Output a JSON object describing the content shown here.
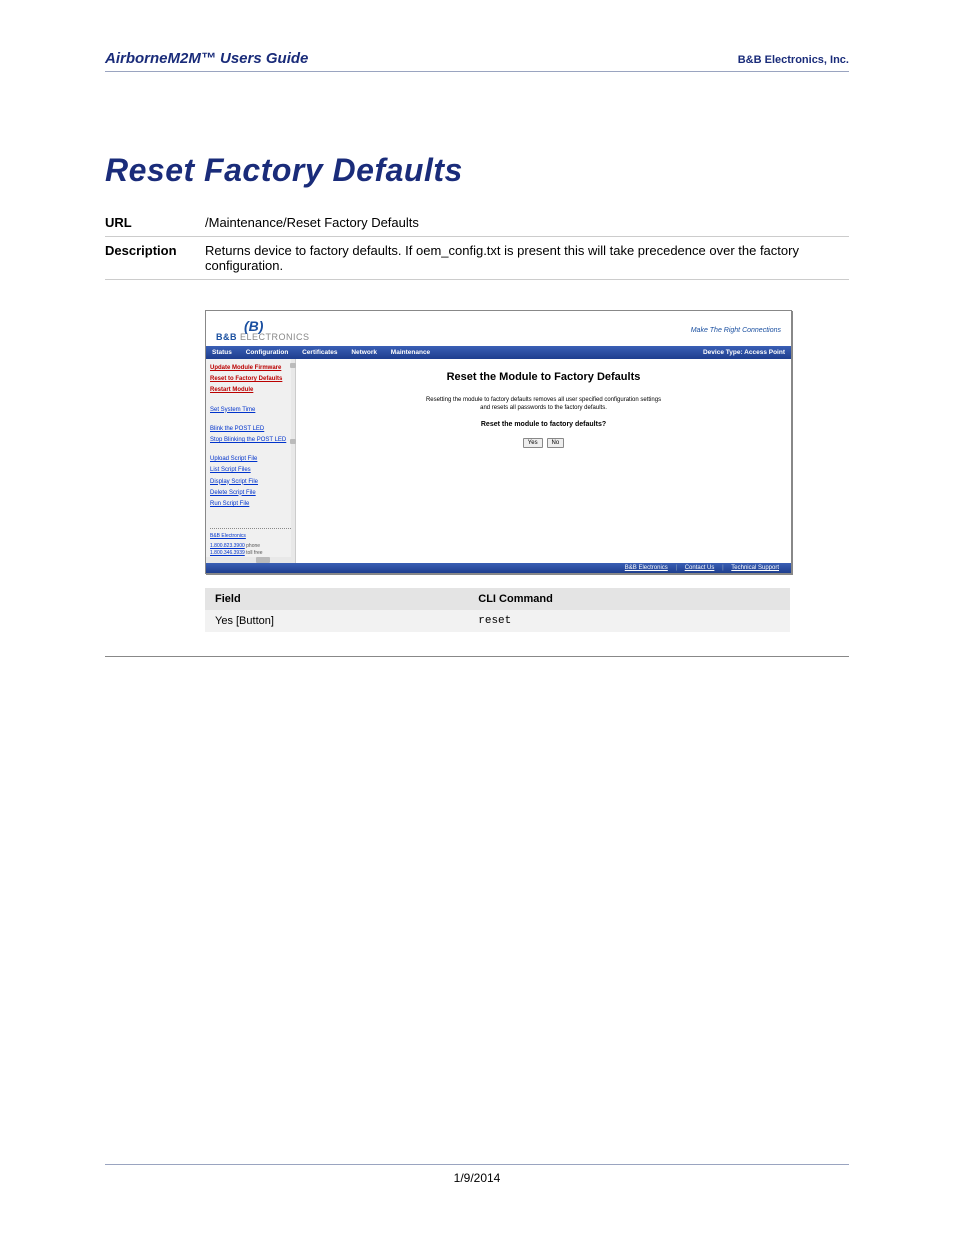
{
  "header": {
    "left": "AirborneM2M™ Users Guide",
    "right": "B&B Electronics, Inc."
  },
  "title": "Reset Factory Defaults",
  "info": {
    "url_label": "URL",
    "url_value": "/Maintenance/Reset Factory Defaults",
    "desc_label": "Description",
    "desc_value": "Returns device to factory defaults. If oem_config.txt is present this will take precedence over the factory configuration."
  },
  "screenshot": {
    "logo_b": "(B)",
    "logo_text_bold": "B&B",
    "logo_text_gray": " ELECTRONICS",
    "tagline": "Make The Right Connections",
    "nav": {
      "items": [
        "Status",
        "Configuration",
        "Certificates",
        "Network",
        "Maintenance"
      ],
      "right": "Device Type: Access Point"
    },
    "sidebar": {
      "group1": [
        "Update Module Firmware",
        "Reset to Factory Defaults",
        "Restart Module"
      ],
      "group2": [
        "Set System Time"
      ],
      "group3": [
        "Blink the POST LED",
        "Stop Blinking the POST LED"
      ],
      "group4": [
        "Upload Script File",
        "List Script Files",
        "Display Script File",
        "Delete Script File",
        "Run Script File"
      ],
      "company": {
        "name": "B&B Electronics",
        "phone_num": "1.800.823.3900",
        "phone_lbl": "phone",
        "toll_num": "1.800.346.3939",
        "toll_lbl": "toll free"
      }
    },
    "main": {
      "heading": "Reset the Module to Factory Defaults",
      "desc1": "Resetting the module to factory defaults removes all user specified configuration settings",
      "desc2": "and resets all passwords to the factory defaults.",
      "question": "Reset the module to factory defaults?",
      "yes": "Yes",
      "no": "No"
    },
    "footer_links": [
      "B&B Electronics",
      "Contact Us",
      "Technical Support"
    ]
  },
  "cli": {
    "col1": "Field",
    "col2": "CLI Command",
    "row_field": "Yes [Button]",
    "row_cmd": "reset"
  },
  "footer_date": "1/9/2014"
}
